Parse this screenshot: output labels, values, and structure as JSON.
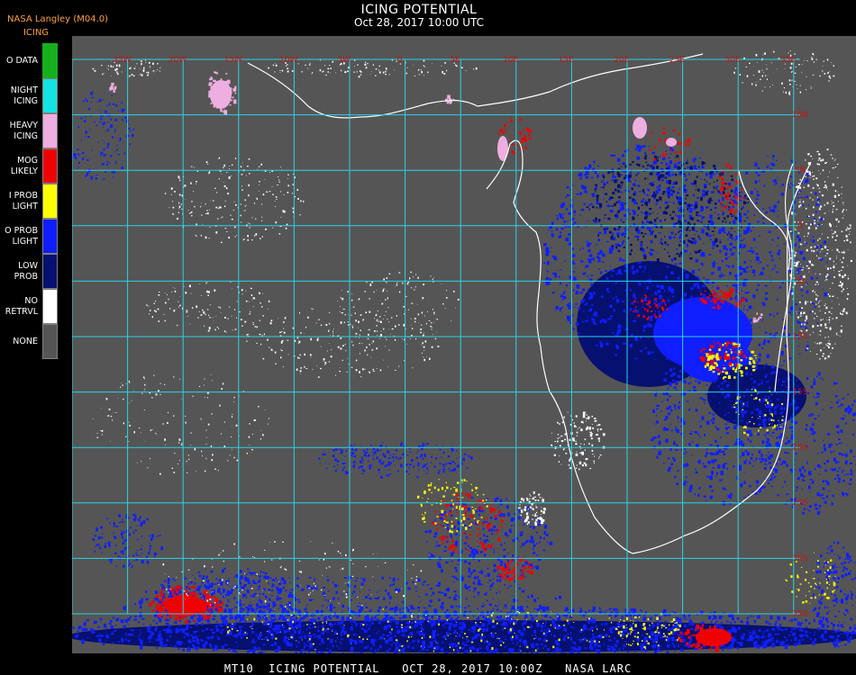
{
  "header": {
    "org": "NASA Langley (M04.0)",
    "product": "ICING",
    "title": "ICING POTENTIAL",
    "datetime": "Oct 28, 2017 10:00 UTC"
  },
  "legend": [
    {
      "lines": [
        "O DATA"
      ],
      "color": "#16b01c"
    },
    {
      "lines": [
        "NIGHT",
        "ICING"
      ],
      "color": "#13e3e3"
    },
    {
      "lines": [
        "HEAVY",
        "ICING"
      ],
      "color": "#eeaee0"
    },
    {
      "lines": [
        "MOG",
        "LIKELY"
      ],
      "color": "#f00000"
    },
    {
      "lines": [
        "I PROB",
        "LIGHT"
      ],
      "color": "#ffff00"
    },
    {
      "lines": [
        "O PROB",
        "LIGHT"
      ],
      "color": "#0f1eff"
    },
    {
      "lines": [
        "LOW",
        "PROB"
      ],
      "color": "#061070"
    },
    {
      "lines": [
        "NO",
        "RETRVL"
      ],
      "color": "#ffffff"
    },
    {
      "lines": [
        "NONE"
      ],
      "color": "#555555"
    }
  ],
  "map": {
    "grid_color": "#2ad4e8",
    "label_color": "#d01010",
    "coastline_color": "#ffffff",
    "top_labels": [
      "25W",
      "20W",
      "15W",
      "10W",
      "5W",
      "0",
      "5E",
      "10E",
      "15E",
      "20E",
      "25E",
      "30E",
      "35E"
    ],
    "right_labels": [
      "10N",
      "5N",
      "0",
      "5S",
      "10S",
      "15S",
      "20S",
      "25S",
      "30S",
      "35S",
      "40S"
    ]
  },
  "footer": "MT10  ICING POTENTIAL   OCT 28, 2017 10:00Z   NASA LARC"
}
